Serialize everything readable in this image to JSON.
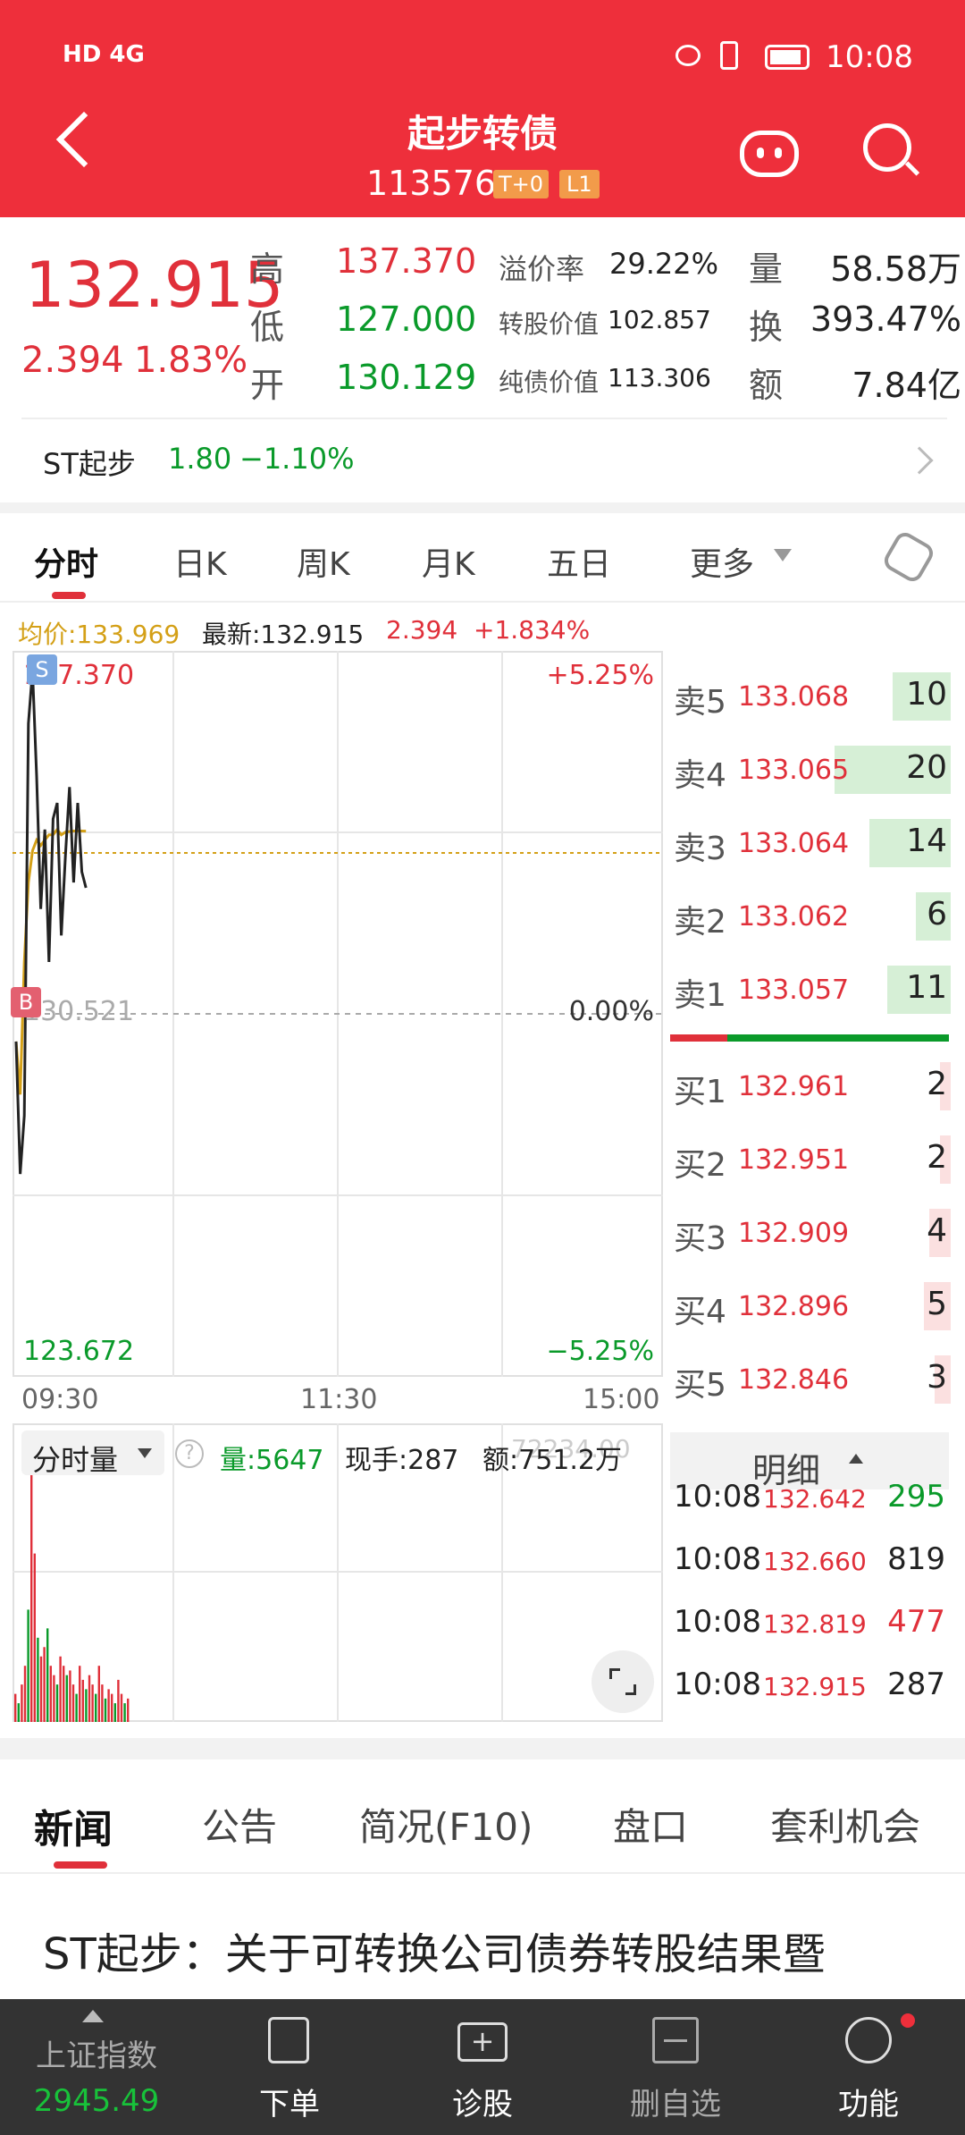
{
  "status_bar": {
    "left": "HD 4G",
    "time": "10:08"
  },
  "header": {
    "title": "起步转债",
    "code": "113576",
    "badge1": "T+0",
    "badge2": "L1"
  },
  "quote": {
    "price": "132.915",
    "change": "2.394",
    "change_pct": "1.83%",
    "high_label": "高",
    "high": "137.370",
    "low_label": "低",
    "low": "127.000",
    "open_label": "开",
    "open": "130.129",
    "premium_label": "溢价率",
    "premium": "29.22%",
    "conv_label": "转股价值",
    "conv": "102.857",
    "bond_label": "纯债价值",
    "bond": "113.306",
    "vol_label": "量",
    "vol": "58.58万",
    "turn_label": "换",
    "turn": "393.47%",
    "amt_label": "额",
    "amt": "7.84亿"
  },
  "underlying": {
    "name": "ST起步",
    "price": "1.80",
    "pct": "−1.10%"
  },
  "chart_tabs": [
    "分时",
    "日K",
    "周K",
    "月K",
    "五日",
    "更多"
  ],
  "info_bar": {
    "avg": "均价:133.969",
    "latest": "最新:132.915",
    "chg": "2.394",
    "pct": "+1.834%"
  },
  "intraday": {
    "top_price": "137.370",
    "top_pct": "+5.25%",
    "mid_price": "130.521",
    "mid_pct": "0.00%",
    "bot_price": "123.672",
    "bot_pct": "−5.25%",
    "t_start": "09:30",
    "t_mid": "11:30",
    "t_end": "15:00",
    "marker_s": "S",
    "marker_b": "B",
    "ylim": [
      123.672,
      137.37
    ]
  },
  "chart_data": {
    "type": "line",
    "series": [
      {
        "values": [
          130.0,
          127.5,
          128.6,
          136.0,
          137.0,
          135.0,
          132.5,
          134.0,
          131.5,
          134.2,
          134.5,
          132.0,
          133.5,
          134.8,
          133.0,
          134.5,
          133.2,
          132.9
        ]
      },
      {
        "values": [
          130.0,
          129.0,
          131.5,
          133.0,
          133.6,
          133.8,
          133.7,
          133.8,
          133.9,
          133.9,
          134.0,
          133.9,
          133.95,
          133.96,
          133.97,
          133.97,
          133.97,
          133.969
        ]
      }
    ],
    "ylim": [
      123.672,
      137.37
    ]
  },
  "orderbook": {
    "sells": [
      {
        "label": "卖5",
        "price": "133.068",
        "qty": "10"
      },
      {
        "label": "卖4",
        "price": "133.065",
        "qty": "20"
      },
      {
        "label": "卖3",
        "price": "133.064",
        "qty": "14"
      },
      {
        "label": "卖2",
        "price": "133.062",
        "qty": "6"
      },
      {
        "label": "卖1",
        "price": "133.057",
        "qty": "11"
      }
    ],
    "buys": [
      {
        "label": "买1",
        "price": "132.961",
        "qty": "2"
      },
      {
        "label": "买2",
        "price": "132.951",
        "qty": "2"
      },
      {
        "label": "买3",
        "price": "132.909",
        "qty": "4"
      },
      {
        "label": "买4",
        "price": "132.896",
        "qty": "5"
      },
      {
        "label": "买5",
        "price": "132.846",
        "qty": "3"
      }
    ]
  },
  "volume_bar": {
    "label": "分时量",
    "vol": "量:5647",
    "hand": "现手:287",
    "amt": "额:751.2万",
    "ghost": "72234.00"
  },
  "volume_data": {
    "values": [
      30,
      20,
      40,
      60,
      120,
      300,
      180,
      90,
      70,
      80,
      100,
      60,
      50,
      40,
      70,
      60,
      50,
      55,
      40,
      30,
      60,
      45,
      35,
      50,
      40,
      30,
      60,
      40,
      25,
      35,
      30,
      20,
      45,
      30,
      20,
      25
    ]
  },
  "detail": {
    "title": "明细",
    "rows": [
      {
        "time": "10:08",
        "price": "132.642",
        "qty": "295"
      },
      {
        "time": "10:08",
        "price": "132.660",
        "qty": "819"
      },
      {
        "time": "10:08",
        "price": "132.819",
        "qty": "477"
      },
      {
        "time": "10:08",
        "price": "132.915",
        "qty": "287"
      }
    ]
  },
  "news_tabs": [
    "新闻",
    "公告",
    "简况(F10)",
    "盘口",
    "套利机会"
  ],
  "headline": "ST起步：关于可转换公司债券转股结果暨",
  "bottom_nav": {
    "index_name": "上证指数",
    "index_val": "2945.49",
    "items": [
      "下单",
      "诊股",
      "删自选",
      "功能"
    ]
  },
  "colors": {
    "header": "#ee2f3b",
    "up": "#e0303a",
    "down": "#0a9a2a",
    "avg_line": "#d4a017"
  }
}
